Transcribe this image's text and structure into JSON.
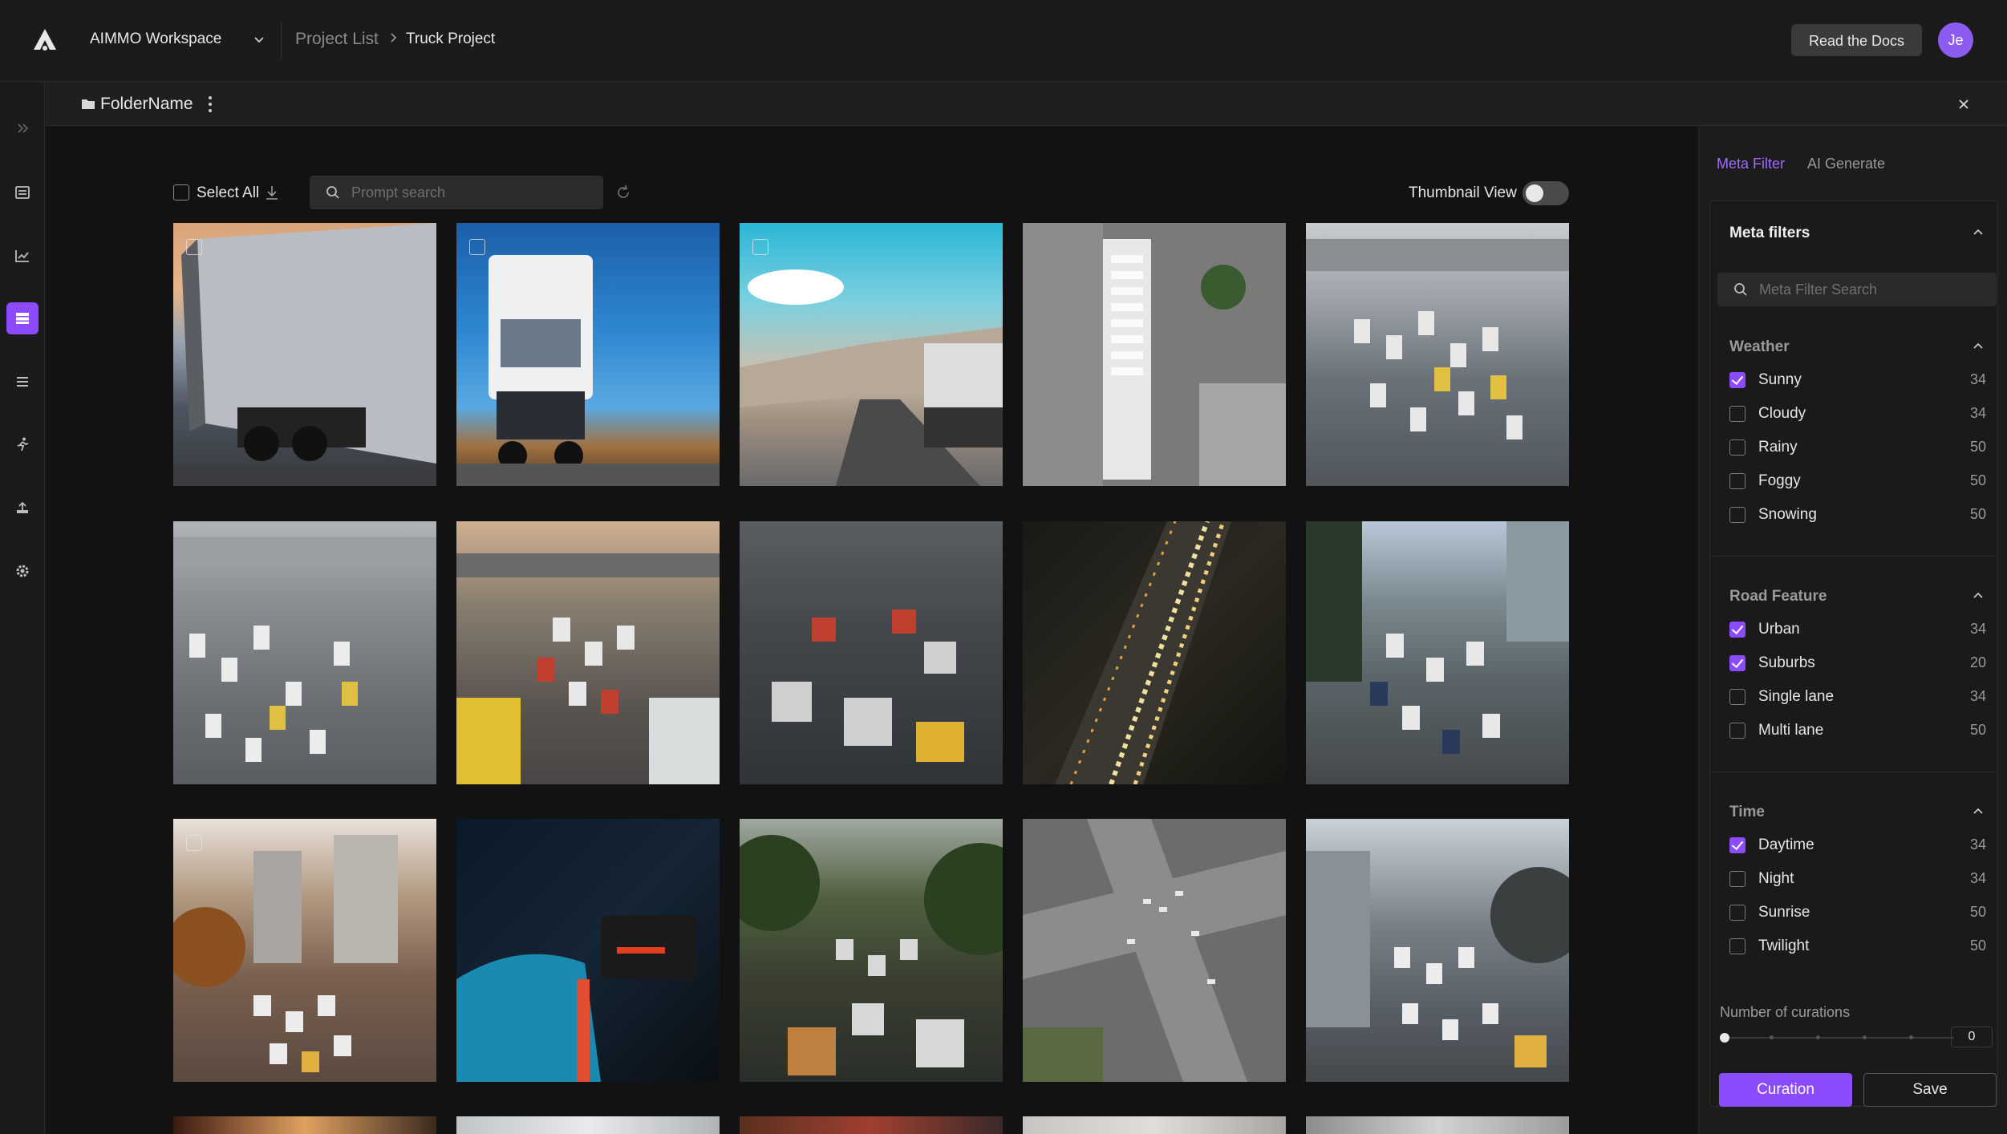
{
  "header": {
    "workspace": "AIMMO Workspace",
    "breadcrumb": [
      "Project List",
      "Truck Project"
    ],
    "docs_button": "Read the Docs",
    "avatar_initials": "Je",
    "accent": "#8c4bff"
  },
  "rail": {
    "icons": [
      "expand-icon",
      "list-icon",
      "chart-icon",
      "dataset-icon",
      "menu-icon",
      "run-icon",
      "upload-icon",
      "gear-icon"
    ],
    "active": "dataset-icon"
  },
  "folder": {
    "name": "FolderName"
  },
  "toolbar": {
    "select_all": "Select All",
    "search_placeholder": "Prompt search",
    "thumbnail_view": "Thumbnail View",
    "thumbnail_view_on": false
  },
  "panel": {
    "tabs": [
      "Meta Filter",
      "AI Generate"
    ],
    "active_tab": "Meta Filter",
    "meta_filters_title": "Meta filters",
    "search_placeholder": "Meta Filter Search",
    "sections": [
      {
        "title": "Weather",
        "options": [
          {
            "label": "Sunny",
            "count": "34",
            "checked": true
          },
          {
            "label": "Cloudy",
            "count": "34",
            "checked": false
          },
          {
            "label": "Rainy",
            "count": "50",
            "checked": false
          },
          {
            "label": "Foggy",
            "count": "50",
            "checked": false
          },
          {
            "label": "Snowing",
            "count": "50",
            "checked": false
          }
        ]
      },
      {
        "title": "Road Feature",
        "options": [
          {
            "label": "Urban",
            "count": "34",
            "checked": true
          },
          {
            "label": "Suburbs",
            "count": "20",
            "checked": true
          },
          {
            "label": "Single lane",
            "count": "34",
            "checked": false
          },
          {
            "label": "Multi lane",
            "count": "50",
            "checked": false
          }
        ]
      },
      {
        "title": "Time",
        "options": [
          {
            "label": "Daytime",
            "count": "34",
            "checked": true
          },
          {
            "label": "Night",
            "count": "34",
            "checked": false
          },
          {
            "label": "Sunrise",
            "count": "50",
            "checked": false
          },
          {
            "label": "Twilight",
            "count": "50",
            "checked": false
          }
        ]
      }
    ],
    "curations_label": "Number of curations",
    "curations_value": "0",
    "curation_button": "Curation",
    "save_button": "Save"
  }
}
